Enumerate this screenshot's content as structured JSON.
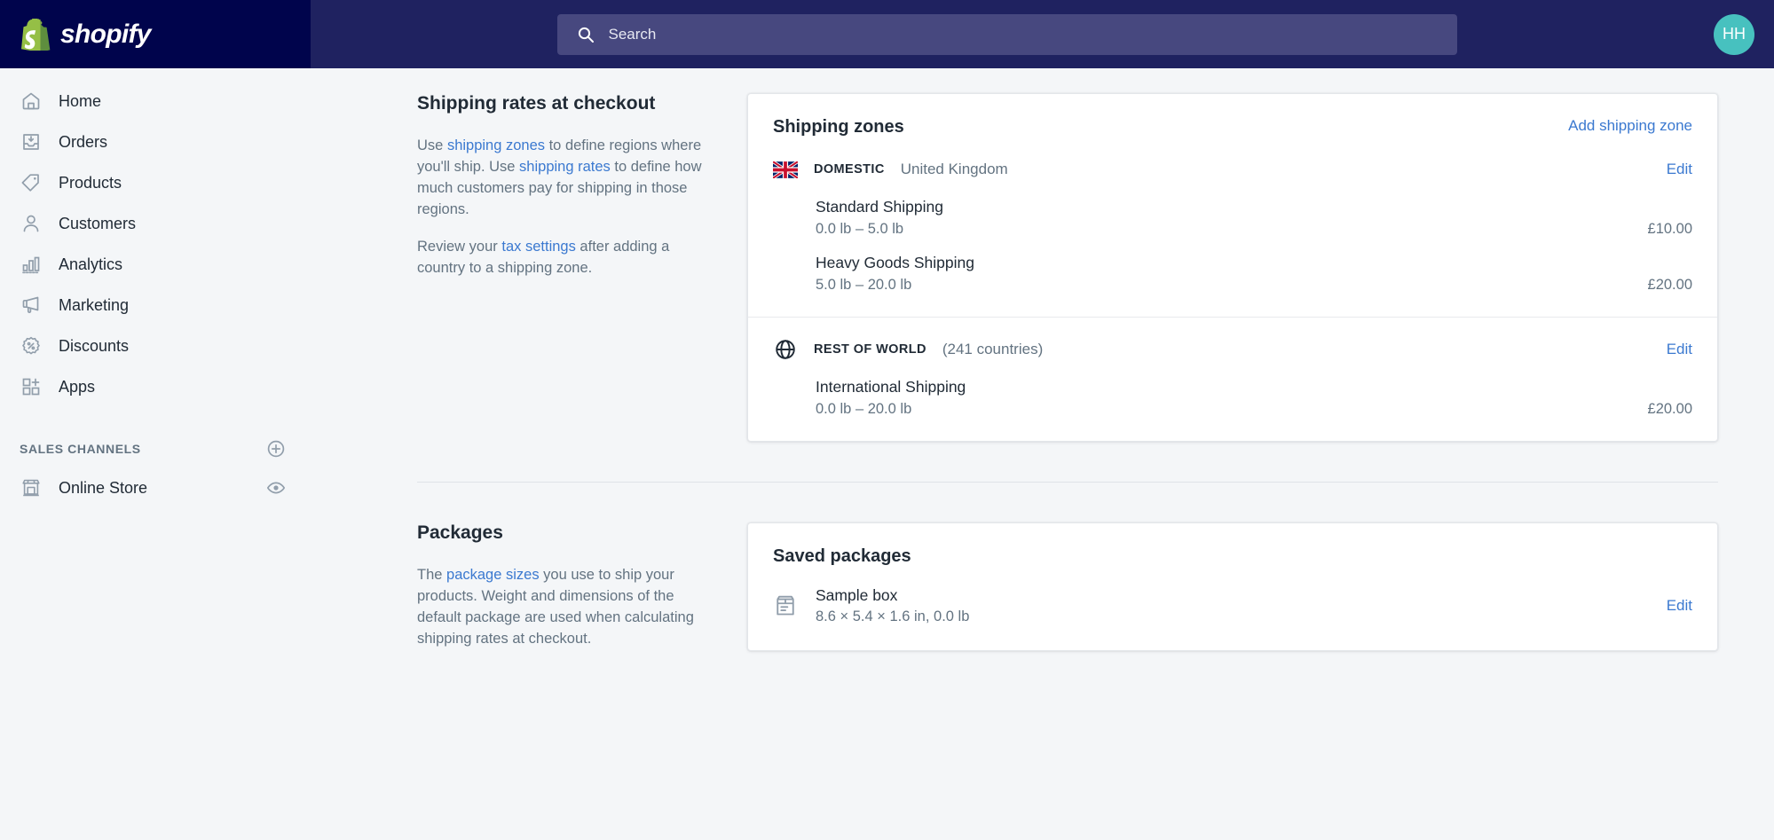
{
  "topbar": {
    "brand": "shopify",
    "brand_icon": "shopify-bag-logo",
    "search": {
      "icon": "search-icon",
      "placeholder": "Search",
      "value": ""
    },
    "avatar": {
      "initials": "HH",
      "color": "#47c1bf"
    }
  },
  "sidebar": {
    "items": [
      {
        "label": "Home",
        "icon": "home-icon"
      },
      {
        "label": "Orders",
        "icon": "orders-inbox-icon"
      },
      {
        "label": "Products",
        "icon": "products-tag-icon"
      },
      {
        "label": "Customers",
        "icon": "customers-person-icon"
      },
      {
        "label": "Analytics",
        "icon": "analytics-bar-chart-icon"
      },
      {
        "label": "Marketing",
        "icon": "marketing-megaphone-icon"
      },
      {
        "label": "Discounts",
        "icon": "discounts-badge-icon"
      },
      {
        "label": "Apps",
        "icon": "apps-grid-plus-icon"
      }
    ],
    "sales_channels": {
      "title": "SALES CHANNELS",
      "add_icon": "plus-circle-icon",
      "channels": [
        {
          "label": "Online Store",
          "icon": "storefront-icon",
          "action_icon": "eye-icon"
        }
      ]
    }
  },
  "main": {
    "shipping": {
      "title": "Shipping rates at checkout",
      "para1_a": "Use ",
      "para1_link1": "shipping zones",
      "para1_b": " to define regions where you'll ship. Use ",
      "para1_link2": "shipping rates",
      "para1_c": " to define how much customers pay for shipping in those regions.",
      "para2_a": "Review your ",
      "para2_link": "tax settings",
      "para2_b": " after adding a country to a shipping zone.",
      "card": {
        "title": "Shipping zones",
        "action": "Add shipping zone",
        "zones": [
          {
            "icon": "uk-flag-icon",
            "name": "DOMESTIC",
            "subtitle": "United Kingdom",
            "edit": "Edit",
            "rates": [
              {
                "name": "Standard Shipping",
                "range": "0.0 lb – 5.0 lb",
                "price": "£10.00"
              },
              {
                "name": "Heavy Goods Shipping",
                "range": "5.0 lb – 20.0 lb",
                "price": "£20.00"
              }
            ]
          },
          {
            "icon": "globe-icon",
            "name": "REST OF WORLD",
            "subtitle": "(241 countries)",
            "edit": "Edit",
            "rates": [
              {
                "name": "International Shipping",
                "range": "0.0 lb – 20.0 lb",
                "price": "£20.00"
              }
            ]
          }
        ]
      }
    },
    "packages": {
      "title": "Packages",
      "para_a": "The ",
      "para_link": "package sizes",
      "para_b": " you use to ship your products. Weight and dimensions of the default package are used when calculating shipping rates at checkout.",
      "card": {
        "title": "Saved packages",
        "items": [
          {
            "icon": "package-box-icon",
            "name": "Sample box",
            "dims": "8.6 × 5.4 × 1.6 in, 0.0 lb",
            "edit": "Edit"
          }
        ]
      }
    }
  }
}
